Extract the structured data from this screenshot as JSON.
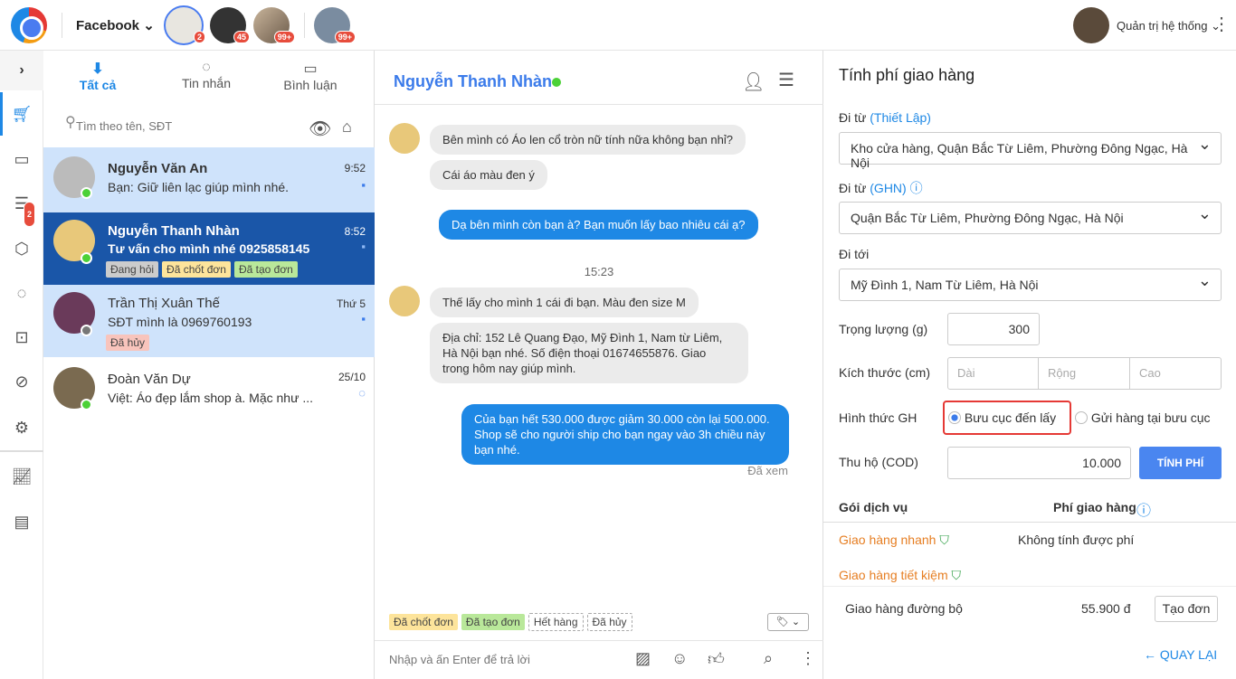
{
  "header": {
    "channel": "Facebook",
    "page_badges": [
      "2",
      "45",
      "99+",
      "99+"
    ],
    "user": "Quản trị hệ thống"
  },
  "rail": {
    "doc_badge": "2"
  },
  "list": {
    "tabs": [
      "Tất cả",
      "Tin nhắn",
      "Bình luận"
    ],
    "search_placeholder": "Tìm theo tên, SĐT",
    "conversations": [
      {
        "name": "Nguyễn Văn An",
        "msg": "Bạn: Giữ liên lạc giúp mình nhé.",
        "time": "9:52"
      },
      {
        "name": "Nguyễn Thanh Nhàn",
        "msg": "Tư vấn cho mình nhé 0925858145",
        "time": "8:52",
        "tags": [
          "Đang hỏi",
          "Đã chốt đơn",
          "Đã tạo đơn"
        ]
      },
      {
        "name": "Trần Thị Xuân Thế",
        "msg": "SĐT mình là 0969760193",
        "time": "Thứ 5",
        "tags": [
          "Đã hủy"
        ]
      },
      {
        "name": "Đoàn Văn Dự",
        "msg": "Việt: Áo đẹp lắm shop à. Mặc như ...",
        "time": "25/10"
      }
    ]
  },
  "chat": {
    "name": "Nguyễn Thanh Nhàn",
    "messages": [
      "Bên mình có Áo len cổ tròn nữ tính nữa không bạn nhỉ?",
      "Cái áo màu đen ý",
      "Dạ bên mình còn bạn à? Bạn muốn lấy bao nhiêu cái ạ?",
      "15:23",
      "Thế lấy cho mình 1 cái đi bạn. Màu đen size M",
      "Địa chỉ: 152 Lê Quang Đạo, Mỹ Đình 1, Nam từ Liêm, Hà Nội bạn nhé. Số điện thoại 01674655876. Giao trong hôm nay giúp mình.",
      "Của bạn hết 530.000 được giảm 30.000 còn lại 500.000. Shop sẽ cho người ship cho bạn ngay vào 3h chiều này bạn nhé."
    ],
    "seen": "Đã xem",
    "quick_tags": [
      "Đã chốt đơn",
      "Đã tạo đơn",
      "Hết hàng",
      "Đã hủy"
    ],
    "input_placeholder": "Nhập và ấn Enter để trả lời"
  },
  "shipping": {
    "title": "Tính phí giao hàng",
    "from_label": "Đi từ",
    "from_link": "(Thiết Lập)",
    "from_value": "Kho cửa hàng, Quận Bắc Từ Liêm, Phường Đông Ngạc, Hà Nội",
    "from_ghn_label": "Đi từ",
    "from_ghn_link": "(GHN)",
    "from_ghn_value": "Quận Bắc Từ Liêm, Phường Đông Ngạc, Hà Nội",
    "to_label": "Đi tới",
    "to_value": "Mỹ Đình 1, Nam Từ Liêm, Hà Nội",
    "weight_label": "Trọng lượng (g)",
    "weight": "300",
    "size_label": "Kích thước (cm)",
    "size_ph": [
      "Dài",
      "Rộng",
      "Cao"
    ],
    "method_label": "Hình thức GH",
    "method_options": [
      "Bưu cục đến lấy",
      "Gửi hàng tại bưu cục"
    ],
    "cod_label": "Thu hộ (COD)",
    "cod": "10.000",
    "calc_btn": "TÍNH PHÍ",
    "col_service": "Gói dịch vụ",
    "col_fee": "Phí giao hàng",
    "fast": "Giao hàng nhanh",
    "fast_fee": "Không tính được phí",
    "saving": "Giao hàng tiết kiệm",
    "road": "Giao hàng đường bộ",
    "road_fee": "55.900 đ",
    "create_btn": "Tạo đơn",
    "back": "QUAY LẠI"
  }
}
